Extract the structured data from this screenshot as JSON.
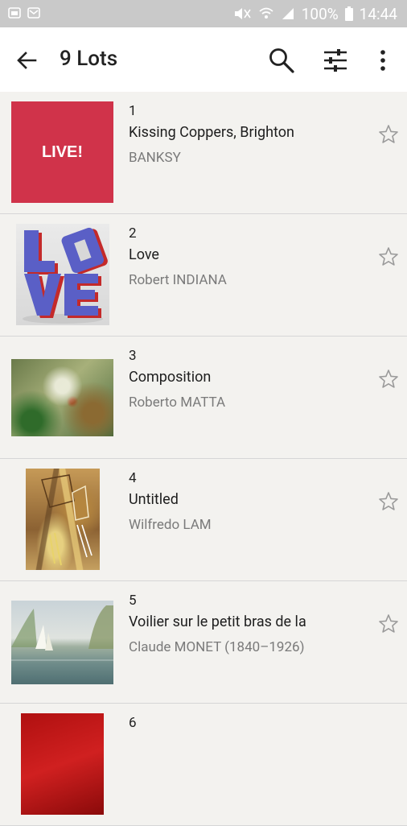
{
  "status": {
    "battery": "100%",
    "time": "14:44"
  },
  "appbar": {
    "title": "9 Lots"
  },
  "lots": [
    {
      "number": "1",
      "title": "Kissing Coppers, Brighton",
      "artist": "BANKSY",
      "thumb_text": "LIVE!"
    },
    {
      "number": "2",
      "title": "Love",
      "artist": "Robert INDIANA"
    },
    {
      "number": "3",
      "title": "Composition",
      "artist": "Roberto MATTA"
    },
    {
      "number": "4",
      "title": "Untitled",
      "artist": "Wilfredo LAM"
    },
    {
      "number": "5",
      "title": "Voilier sur le petit bras de la",
      "artist": "Claude MONET (1840–1926)"
    },
    {
      "number": "6"
    }
  ],
  "colors": {
    "live_red": "#d0334a",
    "love_blue": "#5a5fc6",
    "love_red": "#c42a2a"
  }
}
